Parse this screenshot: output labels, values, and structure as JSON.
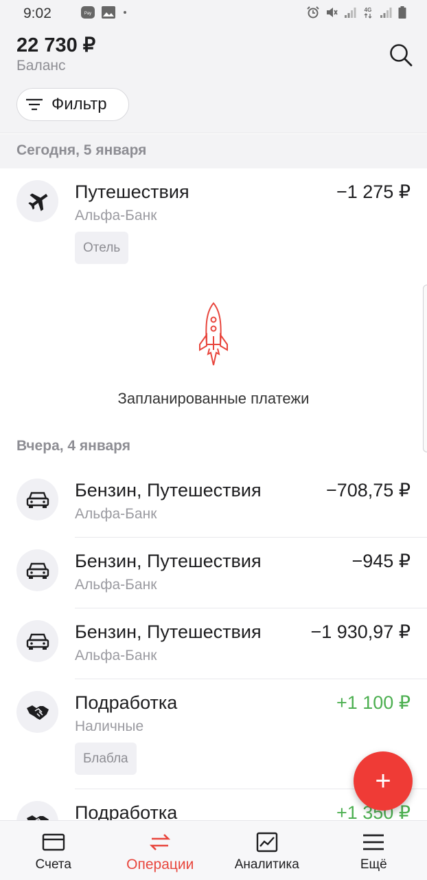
{
  "status_bar": {
    "time": "9:02",
    "left_icons": [
      "samsung-pay-icon",
      "gallery-icon",
      "dot-icon"
    ],
    "right_icons": [
      "alarm-icon",
      "mute-icon",
      "signal-icon",
      "4g-icon",
      "signal-icon",
      "battery-icon"
    ]
  },
  "header": {
    "balance": "22 730 ₽",
    "balance_label": "Баланс",
    "filter_label": "Фильтр",
    "search_icon": "search-icon",
    "filter_icon": "filter-icon"
  },
  "sections": [
    {
      "date": "Сегодня, 5 января",
      "operations": [
        {
          "title": "Путешествия",
          "account": "Альфа-Банк",
          "amount": "−1 275 ₽",
          "tag": "Отель",
          "icon": "airplane-icon",
          "type": "expense"
        }
      ]
    },
    {
      "date": "Вчера, 4 января",
      "operations": [
        {
          "title": "Бензин, Путешествия",
          "account": "Альфа-Банк",
          "amount": "−708,75 ₽",
          "icon": "car-icon",
          "type": "expense"
        },
        {
          "title": "Бензин, Путешествия",
          "account": "Альфа-Банк",
          "amount": "−945 ₽",
          "icon": "car-icon",
          "type": "expense"
        },
        {
          "title": "Бензин, Путешествия",
          "account": "Альфа-Банк",
          "amount": "−1 930,97 ₽",
          "icon": "car-icon",
          "type": "expense"
        },
        {
          "title": "Подработка",
          "account": "Наличные",
          "amount": "+1 100 ₽",
          "tag": "Блабла",
          "icon": "handshake-icon",
          "type": "income"
        },
        {
          "title": "Подработка",
          "account": "",
          "amount": "+1 350 ₽",
          "icon": "handshake-icon",
          "type": "income"
        }
      ]
    }
  ],
  "planned_payments": {
    "label": "Запланированные платежи",
    "icon": "rocket-icon"
  },
  "fab": {
    "label": "+",
    "icon": "plus-icon"
  },
  "bottom_nav": [
    {
      "label": "Счета",
      "icon": "card-icon",
      "active": false
    },
    {
      "label": "Операции",
      "icon": "transfer-arrows-icon",
      "active": true
    },
    {
      "label": "Аналитика",
      "icon": "chart-icon",
      "active": false
    },
    {
      "label": "Ещё",
      "icon": "menu-icon",
      "active": false
    }
  ],
  "colors": {
    "accent": "#e8453c",
    "fab": "#ef3b36",
    "income": "#4caf50",
    "header_bg": "#f3f3f5",
    "muted_text": "#8d8d93"
  }
}
